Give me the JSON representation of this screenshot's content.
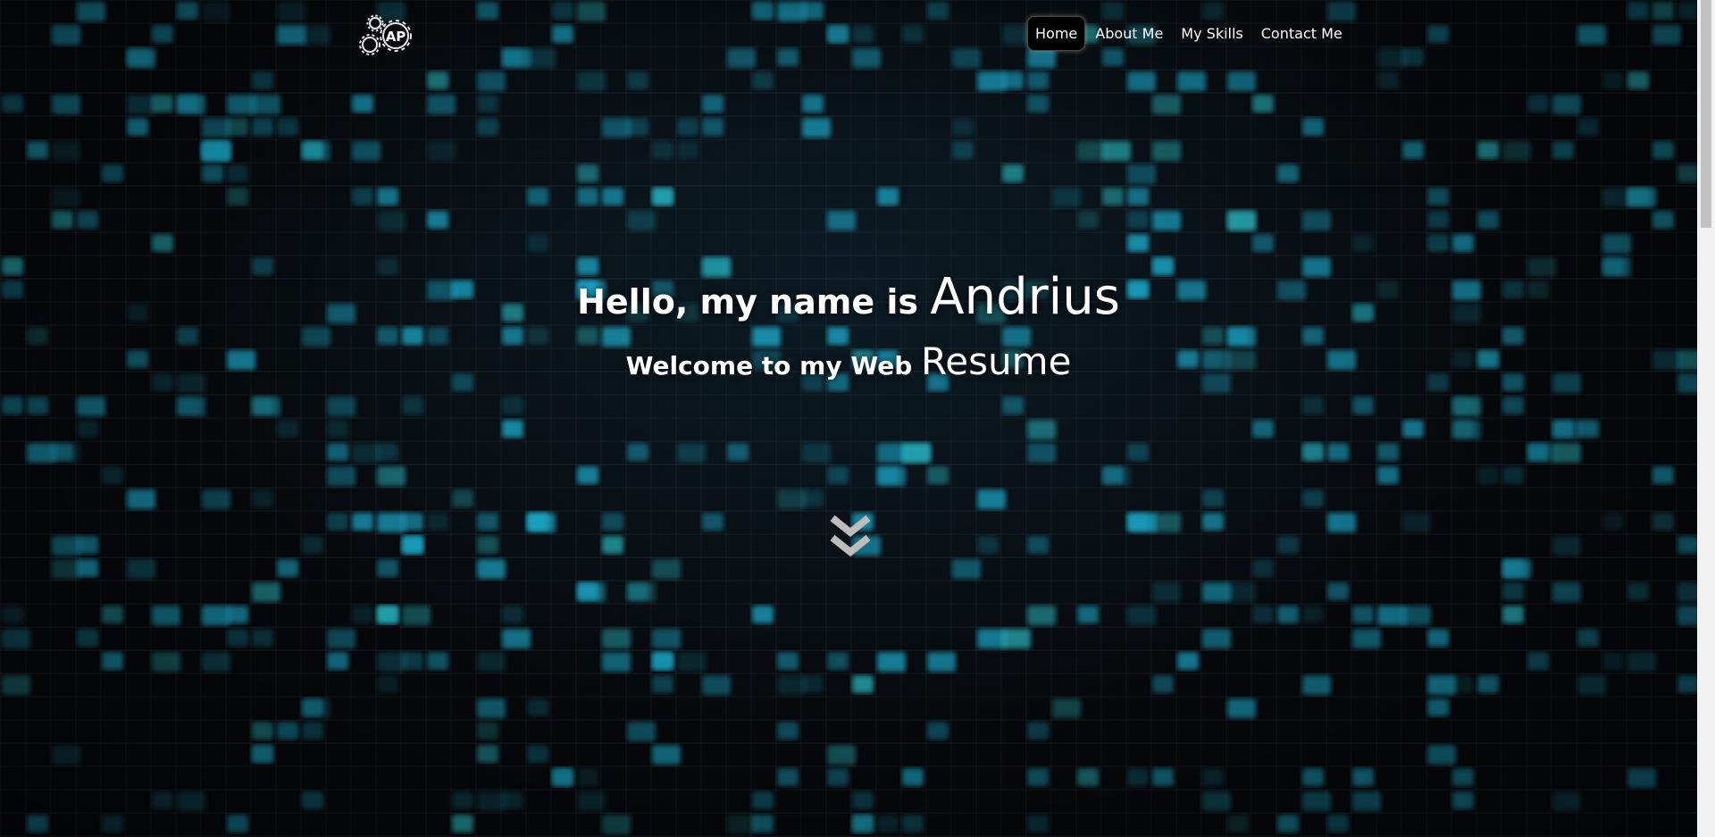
{
  "nav": {
    "logo_icon": "ap-gears-logo-icon",
    "items": [
      {
        "label": "Home",
        "active": true
      },
      {
        "label": "About Me",
        "active": false
      },
      {
        "label": "My Skills",
        "active": false
      },
      {
        "label": "Contact Me",
        "active": false
      }
    ]
  },
  "hero": {
    "greeting": "Hello, my name is ",
    "name": "Andrius",
    "welcome": "Welcome to my Web ",
    "resume": "Resume"
  },
  "scroll_icon": "double-chevron-down-icon",
  "colors": {
    "accent": "#1fb3d6",
    "text": "#ffffff",
    "background": "#07090c"
  }
}
